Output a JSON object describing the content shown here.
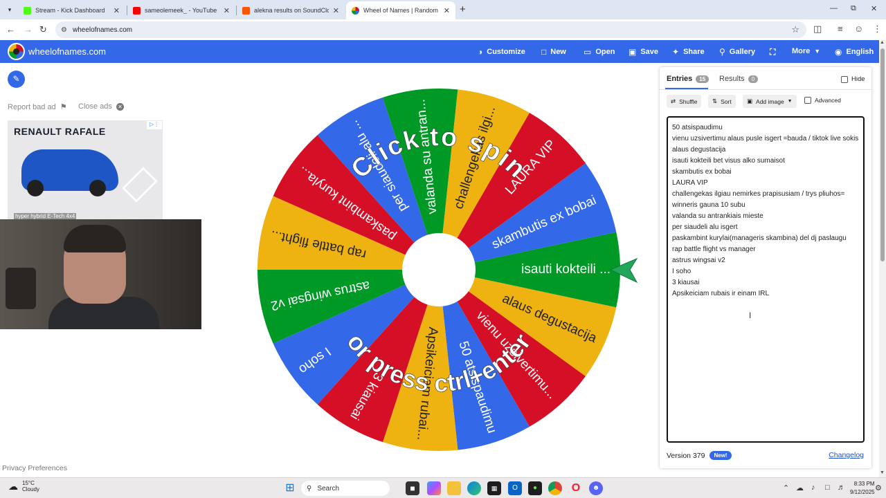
{
  "browser": {
    "tabs": [
      {
        "title": "Stream - Kick Dashboard",
        "favicon_color": "#53fc18",
        "active": false
      },
      {
        "title": "sameolemeek_ - YouTube",
        "favicon_color": "#ff0000",
        "active": false
      },
      {
        "title": "alekna results on SoundCloud",
        "favicon_color": "#ff5500",
        "active": false
      },
      {
        "title": "Wheel of Names | Random nam",
        "favicon_color": "#3369e8",
        "active": true
      }
    ],
    "new_tab_label": "+",
    "url": "wheelofnames.com"
  },
  "site": {
    "name": "wheelofnames.com",
    "nav": {
      "customize": "Customize",
      "new": "New",
      "open": "Open",
      "save": "Save",
      "share": "Share",
      "gallery": "Gallery",
      "more": "More",
      "language": "English"
    }
  },
  "left": {
    "report_bad_ad": "Report bad ad",
    "close_ads": "Close ads",
    "ad": {
      "brand": "RENAULT RAFALE",
      "tagline": "hyper hybrid E-Tech 4x4"
    }
  },
  "wheel": {
    "overlay_top": "Click to spin",
    "overlay_bottom": "or press ctrl+enter",
    "segment_colors": [
      "#eeb211",
      "#d50f25",
      "#3369e8",
      "#009925"
    ],
    "segments": [
      {
        "label": "isauti kokteili ...",
        "color": "#009925"
      },
      {
        "label": "alaus degustacija",
        "color": "#eeb211"
      },
      {
        "label": "vienu uzsivertimu...",
        "color": "#d50f25"
      },
      {
        "label": "50 atsispaudimu",
        "color": "#3369e8"
      },
      {
        "label": "Apsikeiciam rubai...",
        "color": "#eeb211"
      },
      {
        "label": "3 kiausai",
        "color": "#d50f25"
      },
      {
        "label": "I soho",
        "color": "#3369e8"
      },
      {
        "label": "astrus wingsai v2",
        "color": "#009925"
      },
      {
        "label": "rap battle flight...",
        "color": "#eeb211"
      },
      {
        "label": "paskambint kuryla...",
        "color": "#d50f25"
      },
      {
        "label": "per siaudeli alu ...",
        "color": "#3369e8"
      },
      {
        "label": "valanda su antran...",
        "color": "#009925"
      },
      {
        "label": "challengekas ilgi...",
        "color": "#eeb211"
      },
      {
        "label": "LAURA VIP",
        "color": "#d50f25"
      },
      {
        "label": "skambutis ex bobai",
        "color": "#3369e8"
      }
    ]
  },
  "panel": {
    "entries_tab": "Entries",
    "entries_count": "15",
    "results_tab": "Results",
    "results_count": "0",
    "hide_label": "Hide",
    "shuffle": "Shuffle",
    "sort": "Sort",
    "add_image": "Add image",
    "advanced": "Advanced",
    "entries": [
      "50 atsispaudimu",
      "vienu uzsivertimu alaus pusle isgert =bauda / tiktok live sokis",
      "alaus degustacija",
      "isauti kokteili bet visus alko sumaisot",
      "skambutis ex bobai",
      "LAURA VIP",
      "challengekas ilgiau nemirkes prapisusiam / trys pliuhos= winneris gauna 10 subu",
      "valanda su antrankiais mieste",
      "per siaudeli alu isgert",
      "paskambint kurylai(manageris skambina) del dj paslaugu",
      "rap battle flight vs manager",
      "astrus wingsai v2",
      "I soho",
      "3 kiausai",
      "Apsikeiciam rubais ir einam IRL"
    ],
    "version": "Version 379",
    "new_badge": "New!",
    "changelog": "Changelog"
  },
  "privacy": "Privacy Preferences",
  "taskbar": {
    "weather_temp": "15°C",
    "weather_desc": "Cloudy",
    "search_placeholder": "Search",
    "time": "8:33 PM",
    "date": "9/12/2025"
  }
}
